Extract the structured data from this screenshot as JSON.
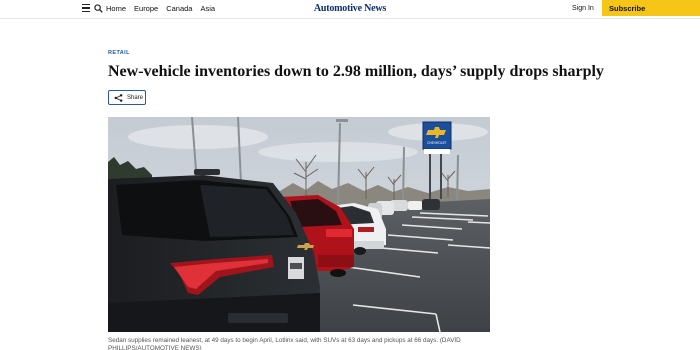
{
  "header": {
    "nav": [
      "Home",
      "Europe",
      "Canada",
      "Asia"
    ],
    "logo": "Automotive News",
    "signin": "Sign In",
    "subscribe": "Subscribe"
  },
  "article": {
    "category": "RETAIL",
    "headline": "New-vehicle inventories down to 2.98 million, days’ supply drops sharply",
    "share_label": "Share",
    "photo": {
      "dealer_sign_text": "CHEVROLET"
    },
    "caption": "Sedan supplies remained leanest, at 49 days to begin April, Lotlinx said, with SUVs at 63 days and pickups at 66 days. (DAVID PHILLIPS/AUTOMOTIVE NEWS)"
  },
  "colors": {
    "accent_blue": "#1f5aa6",
    "logo_navy": "#0f2f6b",
    "subscribe_yellow": "#f5c518",
    "headline": "#111111"
  },
  "icons": [
    "hamburger-menu-icon",
    "search-icon",
    "share-icon",
    "chevrolet-bowtie-logo"
  ]
}
